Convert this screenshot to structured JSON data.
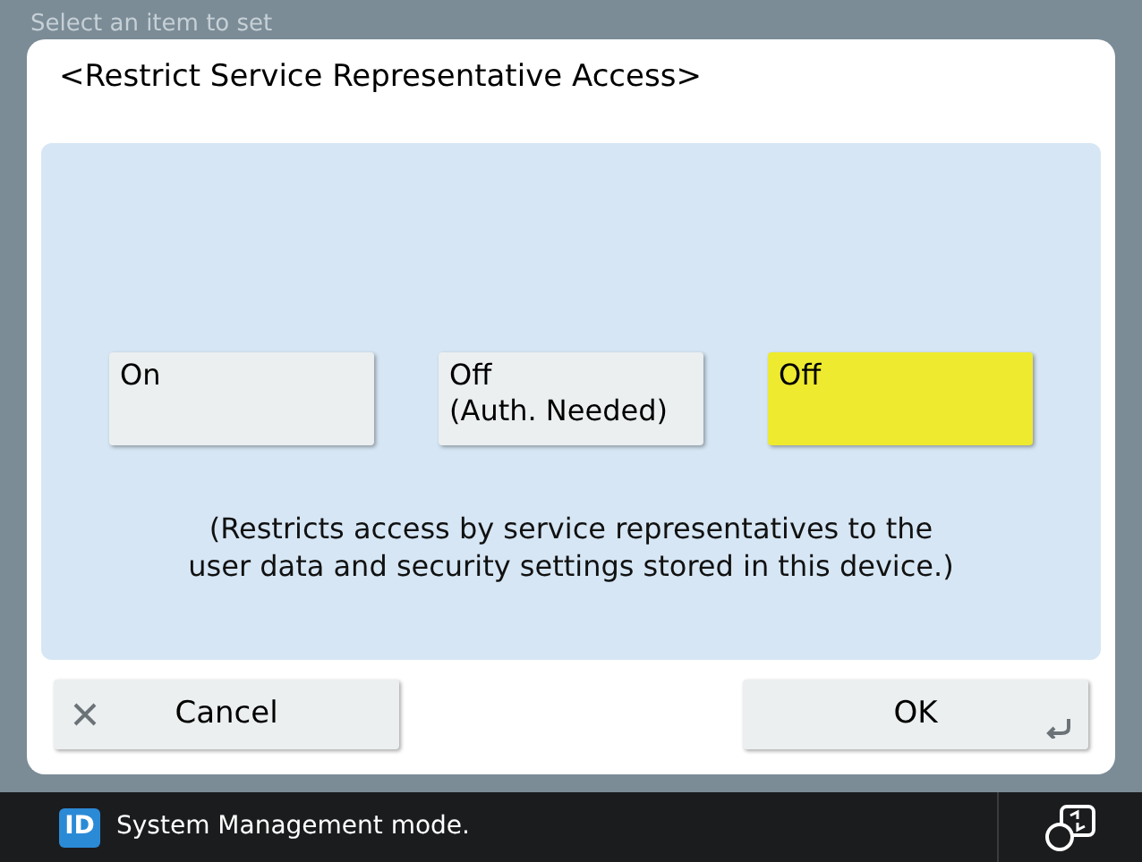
{
  "background_title": "Select an item to set",
  "dialog": {
    "title": "<Restrict Service Representative Access>",
    "options": [
      {
        "label": "On",
        "selected": false
      },
      {
        "label": "Off\n(Auth. Needed)",
        "selected": false
      },
      {
        "label": "Off",
        "selected": true
      }
    ],
    "description": "(Restricts access by service representatives to the\nuser data and security settings stored in this device.)",
    "cancel": "Cancel",
    "ok": "OK"
  },
  "status_bar": {
    "badge": "ID",
    "text": "System Management mode."
  }
}
